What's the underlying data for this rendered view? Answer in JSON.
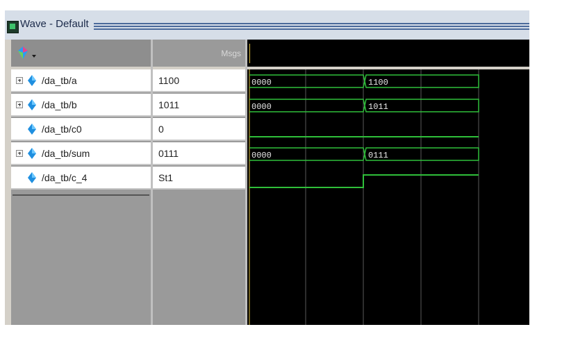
{
  "window": {
    "title": "Wave - Default",
    "accent_color": "#4b6a9b"
  },
  "header": {
    "tool_icon": "wave-tool-icon",
    "values_label": "Msgs"
  },
  "signals": [
    {
      "name": "/da_tb/a",
      "value": "1100",
      "expandable": true,
      "bus": [
        "0000",
        "1100"
      ]
    },
    {
      "name": "/da_tb/b",
      "value": "1011",
      "expandable": true,
      "bus": [
        "0000",
        "1011"
      ]
    },
    {
      "name": "/da_tb/c0",
      "value": "0",
      "expandable": false
    },
    {
      "name": "/da_tb/sum",
      "value": "0111",
      "expandable": true,
      "bus": [
        "0000",
        "0111"
      ]
    },
    {
      "name": "/da_tb/c_4",
      "value": "St1",
      "expandable": false
    }
  ],
  "colors": {
    "wave": "#2fbf3a",
    "grid": "#5a5a5a",
    "cursor": "#e0c040",
    "wave_bg": "#000000"
  }
}
